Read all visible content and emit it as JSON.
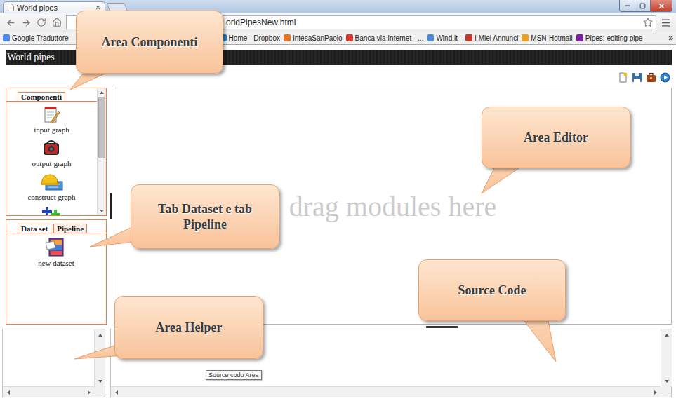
{
  "browser": {
    "tab": {
      "title": "World pipes",
      "close": "×"
    },
    "address": "orldPipesNew.html",
    "bookmarks": [
      {
        "label": "Google Traduttore",
        "color": "#4a8af4"
      },
      {
        "label": "Home - Dropbox",
        "color": "#2d7fd3"
      },
      {
        "label": "IntesaSanPaolo",
        "color": "#e8742a"
      },
      {
        "label": "Banca via Internet - ...",
        "color": "#d9352b"
      },
      {
        "label": "Wind.it -",
        "color": "#4e8ccf"
      },
      {
        "label": "I Miei Annunci",
        "color": "#c0392b"
      },
      {
        "label": "MSN-Hotmail",
        "color": "#f0a020"
      },
      {
        "label": "Pipes: editing pipe",
        "color": "#7b1fa2"
      }
    ],
    "more": "»"
  },
  "app": {
    "title": "World pipes"
  },
  "components_panel": {
    "tab": "Componenti",
    "scroll_level": 0.55,
    "items": [
      {
        "kind": "input",
        "label": "input graph"
      },
      {
        "kind": "output",
        "label": "output graph"
      },
      {
        "kind": "construct",
        "label": "construct graph"
      },
      {
        "kind": "puzzle",
        "label": ""
      }
    ]
  },
  "lower_panel": {
    "tabs": [
      {
        "label": "Data set",
        "selected": true
      },
      {
        "label": "Pipeline",
        "selected": false
      }
    ],
    "items": [
      {
        "label": "new dataset"
      }
    ]
  },
  "editor": {
    "placeholder": "drag modules here"
  },
  "source_tooltip": "Source codo Area",
  "callouts": [
    "Area Componenti",
    "Area Editor",
    "Tab Dataset e tab Pipeline",
    "Source Code",
    "Area Helper"
  ]
}
